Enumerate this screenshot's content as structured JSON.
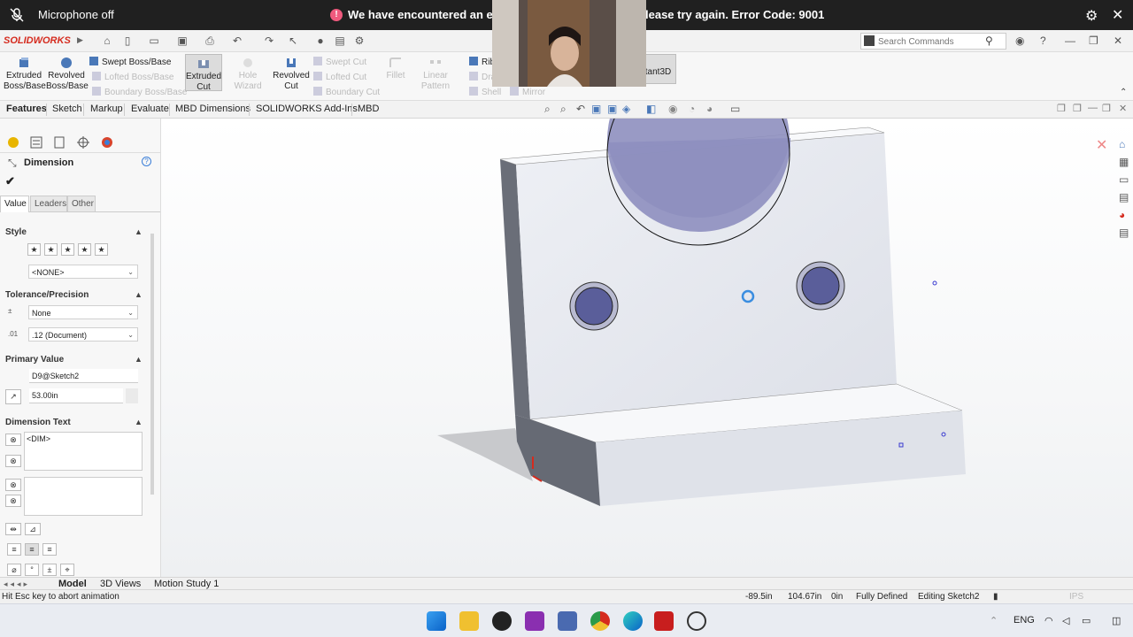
{
  "top_bar": {
    "mic_status": "Microphone off",
    "error_part_a": "We have encountered an error",
    "error_part_b": "lease try again. Error Code: 9001"
  },
  "command_bar": {
    "logo": "SOLIDWORKS",
    "search": {
      "placeholder": "Search Commands"
    }
  },
  "ribbon": {
    "extruded_boss": "Extruded\nBoss/Base",
    "revolved_boss": "Revolved\nBoss/Base",
    "swept_boss": "Swept Boss/Base",
    "lofted_boss": "Lofted Boss/Base",
    "boundary_boss": "Boundary Boss/Base",
    "extruded_cut": "Extruded\nCut",
    "hole_wizard": "Hole Wizard",
    "revolved_cut": "Revolved\nCut",
    "swept_cut": "Swept Cut",
    "lofted_cut": "Lofted Cut",
    "boundary_cut": "Boundary Cut",
    "fillet": "Fillet",
    "linear_pattern": "Linear Pattern",
    "rib": "Rib",
    "draft": "Dra",
    "shell": "Shell",
    "mirror": "Mirror",
    "instant3d": "stant3D"
  },
  "tabs": [
    "Features",
    "Sketch",
    "Markup",
    "Evaluate",
    "MBD Dimensions",
    "SOLIDWORKS Add-Ins",
    "MBD"
  ],
  "panel": {
    "title": "Dimension",
    "subtabs": [
      "Value",
      "Leaders",
      "Other"
    ],
    "style_label": "Style",
    "style_value": "<NONE>",
    "tolerance_label": "Tolerance/Precision",
    "tolerance_value": "None",
    "precision_value": ".12 (Document)",
    "primary_label": "Primary Value",
    "primary_name": "D9@Sketch2",
    "primary_value": "53.00in",
    "dimtext_label": "Dimension Text",
    "dimtext_value": "<DIM>"
  },
  "bottom_tabs": [
    "Model",
    "3D Views",
    "Motion Study 1"
  ],
  "status": {
    "hint": "Hit Esc key to abort animation",
    "x": "-89.5in",
    "y": "104.67in",
    "z": "0in",
    "state": "Fully Defined",
    "mode": "Editing Sketch2",
    "units": "IPS"
  },
  "tray": {
    "lang": "ENG"
  },
  "colors": {
    "accent": "#d52b1e",
    "sketch_fill": "#8f8fc0"
  }
}
